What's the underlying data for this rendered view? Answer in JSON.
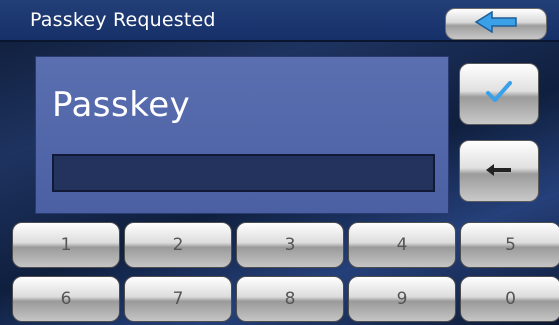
{
  "titlebar": {
    "title": "Passkey Requested",
    "back_icon": "back-arrow-icon"
  },
  "panel": {
    "label": "Passkey",
    "input_value": "",
    "confirm_icon": "checkmark-icon",
    "backspace_icon": "backspace-arrow-icon"
  },
  "keypad": {
    "row1": [
      "1",
      "2",
      "3",
      "4",
      "5"
    ],
    "row2": [
      "6",
      "7",
      "8",
      "9",
      "0"
    ]
  },
  "colors": {
    "accent_blue": "#3aa0e8",
    "panel_blue": "#4b60a3",
    "titlebar_blue": "#16306a"
  }
}
